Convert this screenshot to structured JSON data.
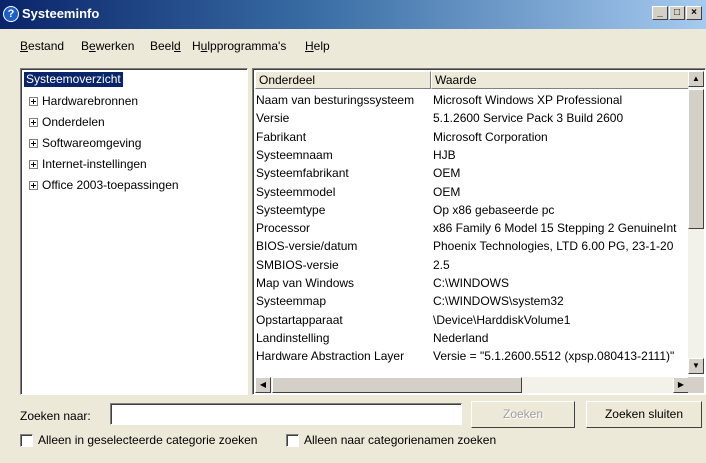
{
  "window": {
    "title": "Systeeminfo",
    "icon": "question-icon"
  },
  "menu": [
    {
      "label_pre": "",
      "label_u": "B",
      "label_post": "estand"
    },
    {
      "label_pre": "B",
      "label_u": "e",
      "label_post": "werken"
    },
    {
      "label_pre": "Beel",
      "label_u": "d",
      "label_post": ""
    },
    {
      "label_pre": "H",
      "label_u": "u",
      "label_post": "lpprogramma's"
    },
    {
      "label_pre": "",
      "label_u": "H",
      "label_post": "elp"
    }
  ],
  "tree": {
    "selected": "Systeemoverzicht",
    "items": [
      "Hardwarebronnen",
      "Onderdelen",
      "Softwareomgeving",
      "Internet-instellingen",
      "Office 2003-toepassingen"
    ]
  },
  "list": {
    "columns": [
      "Onderdeel",
      "Waarde"
    ],
    "rows": [
      [
        "Naam van besturingssysteem",
        "Microsoft Windows XP Professional"
      ],
      [
        "Versie",
        "5.1.2600 Service Pack 3 Build 2600"
      ],
      [
        "Fabrikant",
        "Microsoft Corporation"
      ],
      [
        "Systeemnaam",
        "HJB"
      ],
      [
        "Systeemfabrikant",
        "OEM"
      ],
      [
        "Systeemmodel",
        "OEM"
      ],
      [
        "Systeemtype",
        "Op x86 gebaseerde pc"
      ],
      [
        "Processor",
        "x86 Family 6 Model 15 Stepping 2 GenuineInt"
      ],
      [
        "BIOS-versie/datum",
        "Phoenix Technologies, LTD 6.00 PG, 23-1-20"
      ],
      [
        "SMBIOS-versie",
        "2.5"
      ],
      [
        "Map van Windows",
        "C:\\WINDOWS"
      ],
      [
        "Systeemmap",
        "C:\\WINDOWS\\system32"
      ],
      [
        "Opstartapparaat",
        "\\Device\\HarddiskVolume1"
      ],
      [
        "Landinstelling",
        "Nederland"
      ],
      [
        "Hardware Abstraction Layer",
        "Versie = \"5.1.2600.5512 (xpsp.080413-2111)\""
      ]
    ]
  },
  "search": {
    "label": "Zoeken naar:",
    "value": "",
    "search_button": "Zoeken",
    "close_button": "Zoeken sluiten",
    "checkbox_selected_category": "Alleen in geselecteerde categorie zoeken",
    "checkbox_category_names": "Alleen naar categorienamen zoeken"
  }
}
